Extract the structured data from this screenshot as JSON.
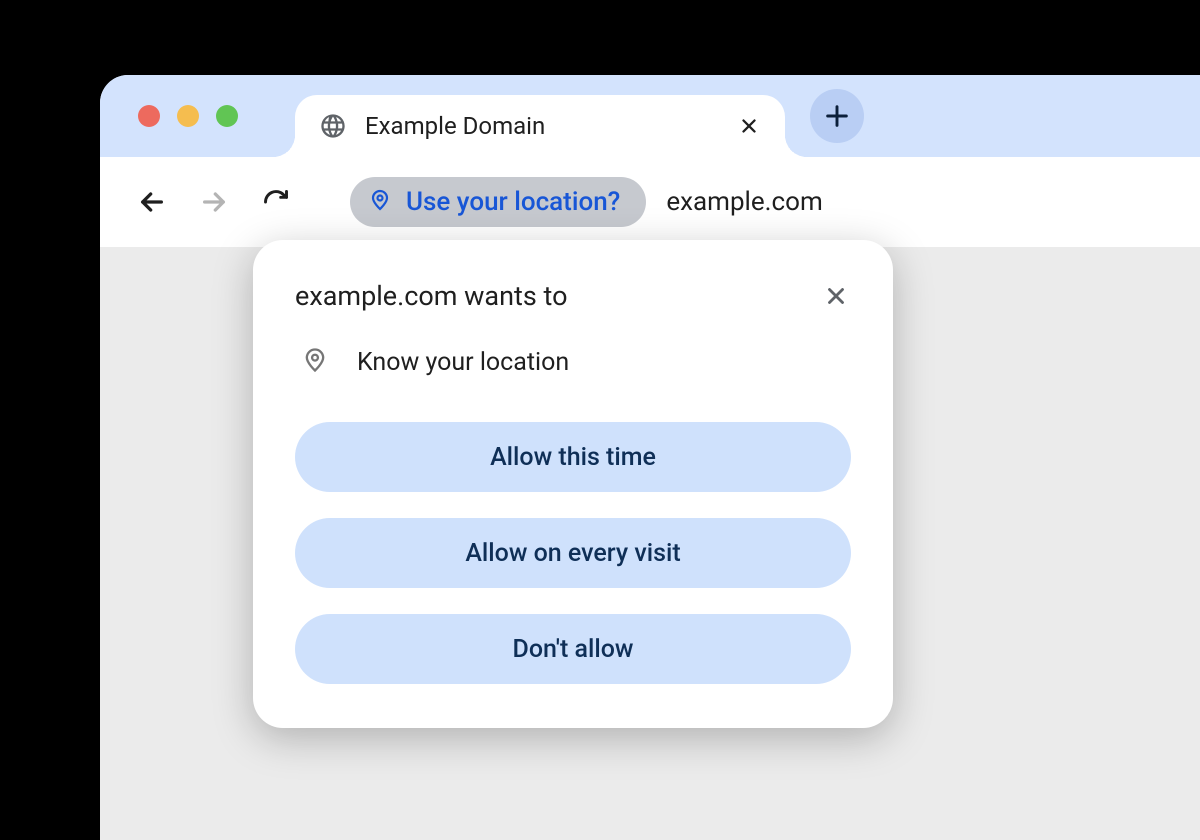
{
  "tab": {
    "title": "Example Domain"
  },
  "toolbar": {
    "permission_chip": "Use your location?",
    "url": "example.com"
  },
  "popover": {
    "title": "example.com wants to",
    "permission_label": "Know your location",
    "buttons": {
      "allow_once": "Allow this time",
      "allow_always": "Allow on every visit",
      "deny": "Don't allow"
    }
  }
}
